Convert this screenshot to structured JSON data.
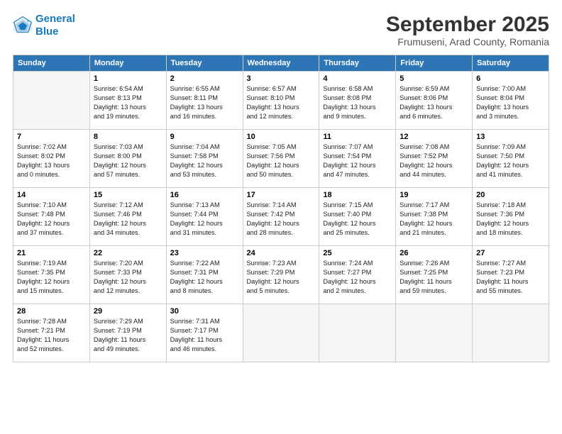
{
  "header": {
    "logo_line1": "General",
    "logo_line2": "Blue",
    "month": "September 2025",
    "location": "Frumuseni, Arad County, Romania"
  },
  "days_of_week": [
    "Sunday",
    "Monday",
    "Tuesday",
    "Wednesday",
    "Thursday",
    "Friday",
    "Saturday"
  ],
  "weeks": [
    [
      {
        "day": "",
        "info": ""
      },
      {
        "day": "1",
        "info": "Sunrise: 6:54 AM\nSunset: 8:13 PM\nDaylight: 13 hours\nand 19 minutes."
      },
      {
        "day": "2",
        "info": "Sunrise: 6:55 AM\nSunset: 8:11 PM\nDaylight: 13 hours\nand 16 minutes."
      },
      {
        "day": "3",
        "info": "Sunrise: 6:57 AM\nSunset: 8:10 PM\nDaylight: 13 hours\nand 12 minutes."
      },
      {
        "day": "4",
        "info": "Sunrise: 6:58 AM\nSunset: 8:08 PM\nDaylight: 13 hours\nand 9 minutes."
      },
      {
        "day": "5",
        "info": "Sunrise: 6:59 AM\nSunset: 8:06 PM\nDaylight: 13 hours\nand 6 minutes."
      },
      {
        "day": "6",
        "info": "Sunrise: 7:00 AM\nSunset: 8:04 PM\nDaylight: 13 hours\nand 3 minutes."
      }
    ],
    [
      {
        "day": "7",
        "info": "Sunrise: 7:02 AM\nSunset: 8:02 PM\nDaylight: 13 hours\nand 0 minutes."
      },
      {
        "day": "8",
        "info": "Sunrise: 7:03 AM\nSunset: 8:00 PM\nDaylight: 12 hours\nand 57 minutes."
      },
      {
        "day": "9",
        "info": "Sunrise: 7:04 AM\nSunset: 7:58 PM\nDaylight: 12 hours\nand 53 minutes."
      },
      {
        "day": "10",
        "info": "Sunrise: 7:05 AM\nSunset: 7:56 PM\nDaylight: 12 hours\nand 50 minutes."
      },
      {
        "day": "11",
        "info": "Sunrise: 7:07 AM\nSunset: 7:54 PM\nDaylight: 12 hours\nand 47 minutes."
      },
      {
        "day": "12",
        "info": "Sunrise: 7:08 AM\nSunset: 7:52 PM\nDaylight: 12 hours\nand 44 minutes."
      },
      {
        "day": "13",
        "info": "Sunrise: 7:09 AM\nSunset: 7:50 PM\nDaylight: 12 hours\nand 41 minutes."
      }
    ],
    [
      {
        "day": "14",
        "info": "Sunrise: 7:10 AM\nSunset: 7:48 PM\nDaylight: 12 hours\nand 37 minutes."
      },
      {
        "day": "15",
        "info": "Sunrise: 7:12 AM\nSunset: 7:46 PM\nDaylight: 12 hours\nand 34 minutes."
      },
      {
        "day": "16",
        "info": "Sunrise: 7:13 AM\nSunset: 7:44 PM\nDaylight: 12 hours\nand 31 minutes."
      },
      {
        "day": "17",
        "info": "Sunrise: 7:14 AM\nSunset: 7:42 PM\nDaylight: 12 hours\nand 28 minutes."
      },
      {
        "day": "18",
        "info": "Sunrise: 7:15 AM\nSunset: 7:40 PM\nDaylight: 12 hours\nand 25 minutes."
      },
      {
        "day": "19",
        "info": "Sunrise: 7:17 AM\nSunset: 7:38 PM\nDaylight: 12 hours\nand 21 minutes."
      },
      {
        "day": "20",
        "info": "Sunrise: 7:18 AM\nSunset: 7:36 PM\nDaylight: 12 hours\nand 18 minutes."
      }
    ],
    [
      {
        "day": "21",
        "info": "Sunrise: 7:19 AM\nSunset: 7:35 PM\nDaylight: 12 hours\nand 15 minutes."
      },
      {
        "day": "22",
        "info": "Sunrise: 7:20 AM\nSunset: 7:33 PM\nDaylight: 12 hours\nand 12 minutes."
      },
      {
        "day": "23",
        "info": "Sunrise: 7:22 AM\nSunset: 7:31 PM\nDaylight: 12 hours\nand 8 minutes."
      },
      {
        "day": "24",
        "info": "Sunrise: 7:23 AM\nSunset: 7:29 PM\nDaylight: 12 hours\nand 5 minutes."
      },
      {
        "day": "25",
        "info": "Sunrise: 7:24 AM\nSunset: 7:27 PM\nDaylight: 12 hours\nand 2 minutes."
      },
      {
        "day": "26",
        "info": "Sunrise: 7:26 AM\nSunset: 7:25 PM\nDaylight: 11 hours\nand 59 minutes."
      },
      {
        "day": "27",
        "info": "Sunrise: 7:27 AM\nSunset: 7:23 PM\nDaylight: 11 hours\nand 55 minutes."
      }
    ],
    [
      {
        "day": "28",
        "info": "Sunrise: 7:28 AM\nSunset: 7:21 PM\nDaylight: 11 hours\nand 52 minutes."
      },
      {
        "day": "29",
        "info": "Sunrise: 7:29 AM\nSunset: 7:19 PM\nDaylight: 11 hours\nand 49 minutes."
      },
      {
        "day": "30",
        "info": "Sunrise: 7:31 AM\nSunset: 7:17 PM\nDaylight: 11 hours\nand 46 minutes."
      },
      {
        "day": "",
        "info": ""
      },
      {
        "day": "",
        "info": ""
      },
      {
        "day": "",
        "info": ""
      },
      {
        "day": "",
        "info": ""
      }
    ]
  ]
}
